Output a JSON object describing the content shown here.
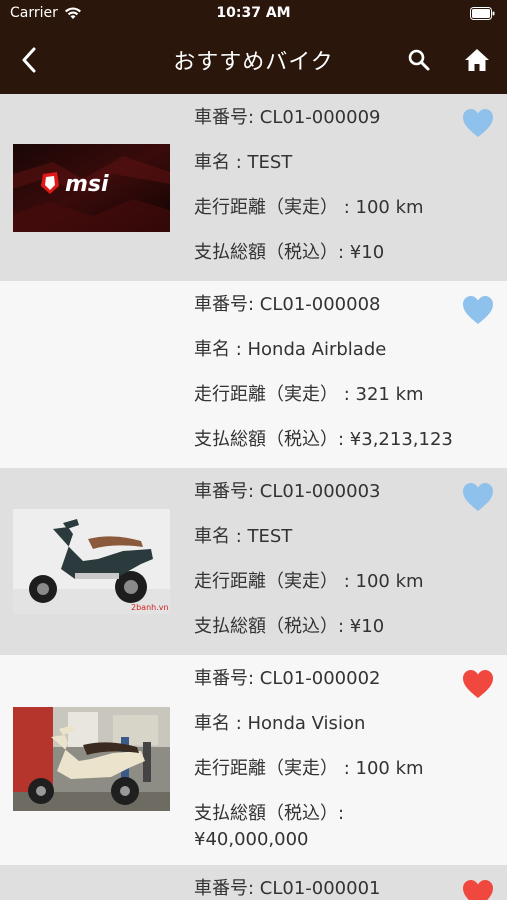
{
  "status_bar": {
    "carrier": "Carrier",
    "time": "10:37 AM"
  },
  "nav": {
    "title": "おすすめバイク",
    "back_icon": "chevron-left-icon",
    "search_icon": "search-icon",
    "home_icon": "home-icon"
  },
  "colors": {
    "nav_bg": "#2a160b",
    "fav_on": "#f0483e",
    "fav_off": "#8ec1ec"
  },
  "items": [
    {
      "number": "車番号: CL01-000009",
      "name": "車名 : TEST",
      "mileage": "走行距離（実走） :  100 km",
      "price": "支払総額（税込）: ¥10",
      "favorite": false,
      "thumb": "msi-logo-image"
    },
    {
      "number": "車番号: CL01-000008",
      "name": "車名 : Honda Airblade",
      "mileage": "走行距離（実走） :  321 km",
      "price": "支払総額（税込）: ¥3,213,123",
      "favorite": false,
      "thumb": ""
    },
    {
      "number": "車番号: CL01-000003",
      "name": "車名 : TEST",
      "mileage": "走行距離（実走） :  100 km",
      "price": "支払総額（税込）: ¥10",
      "favorite": false,
      "thumb": "scooter-image",
      "thumb_caption": "2banh.vn"
    },
    {
      "number": "車番号: CL01-000002",
      "name": "車名 : Honda Vision",
      "mileage": "走行距離（実走） :  100 km",
      "price_label": "支払総額（税込）:",
      "price_value": "¥40,000,000",
      "favorite": true,
      "thumb": "scooter-showroom-image"
    },
    {
      "number": "車番号: CL01-000001",
      "favorite": true
    }
  ]
}
